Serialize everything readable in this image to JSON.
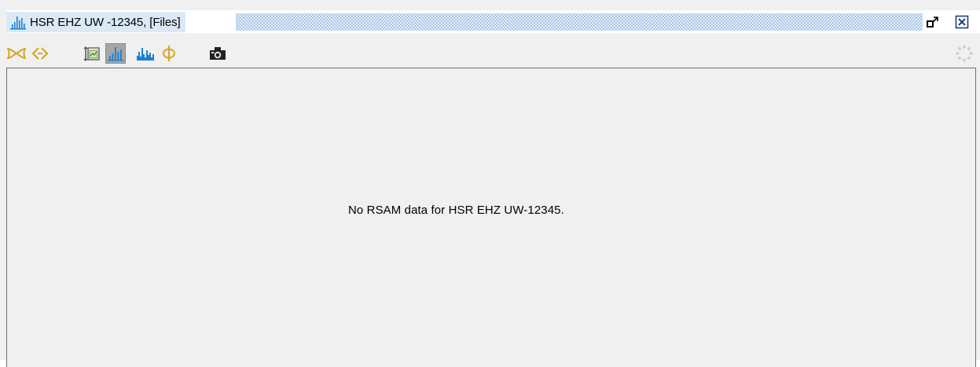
{
  "window": {
    "title": "HSR EHZ UW -12345, [Files]",
    "icon": "rsam-chart-icon",
    "buttons": {
      "restore": "restore-window-icon",
      "close": "close-window-icon"
    }
  },
  "toolbar": {
    "items": [
      {
        "icon": "filter-butterfly-icon"
      },
      {
        "icon": "scroll-arrows-icon"
      },
      {
        "icon": "settings-panel-icon"
      },
      {
        "icon": "rsam-values-icon",
        "active": true
      },
      {
        "icon": "rsam-counts-icon"
      },
      {
        "icon": "phi-icon"
      },
      {
        "icon": "camera-icon"
      }
    ],
    "status_icon": "busy-spinner-icon"
  },
  "panel": {
    "message": "No RSAM data for HSR EHZ UW-12345."
  },
  "colors": {
    "accent": "#1a7fd4",
    "title_bg": "#dbe9f7",
    "icon_gold": "#d9a520",
    "active_bg": "#a6a6a6"
  }
}
